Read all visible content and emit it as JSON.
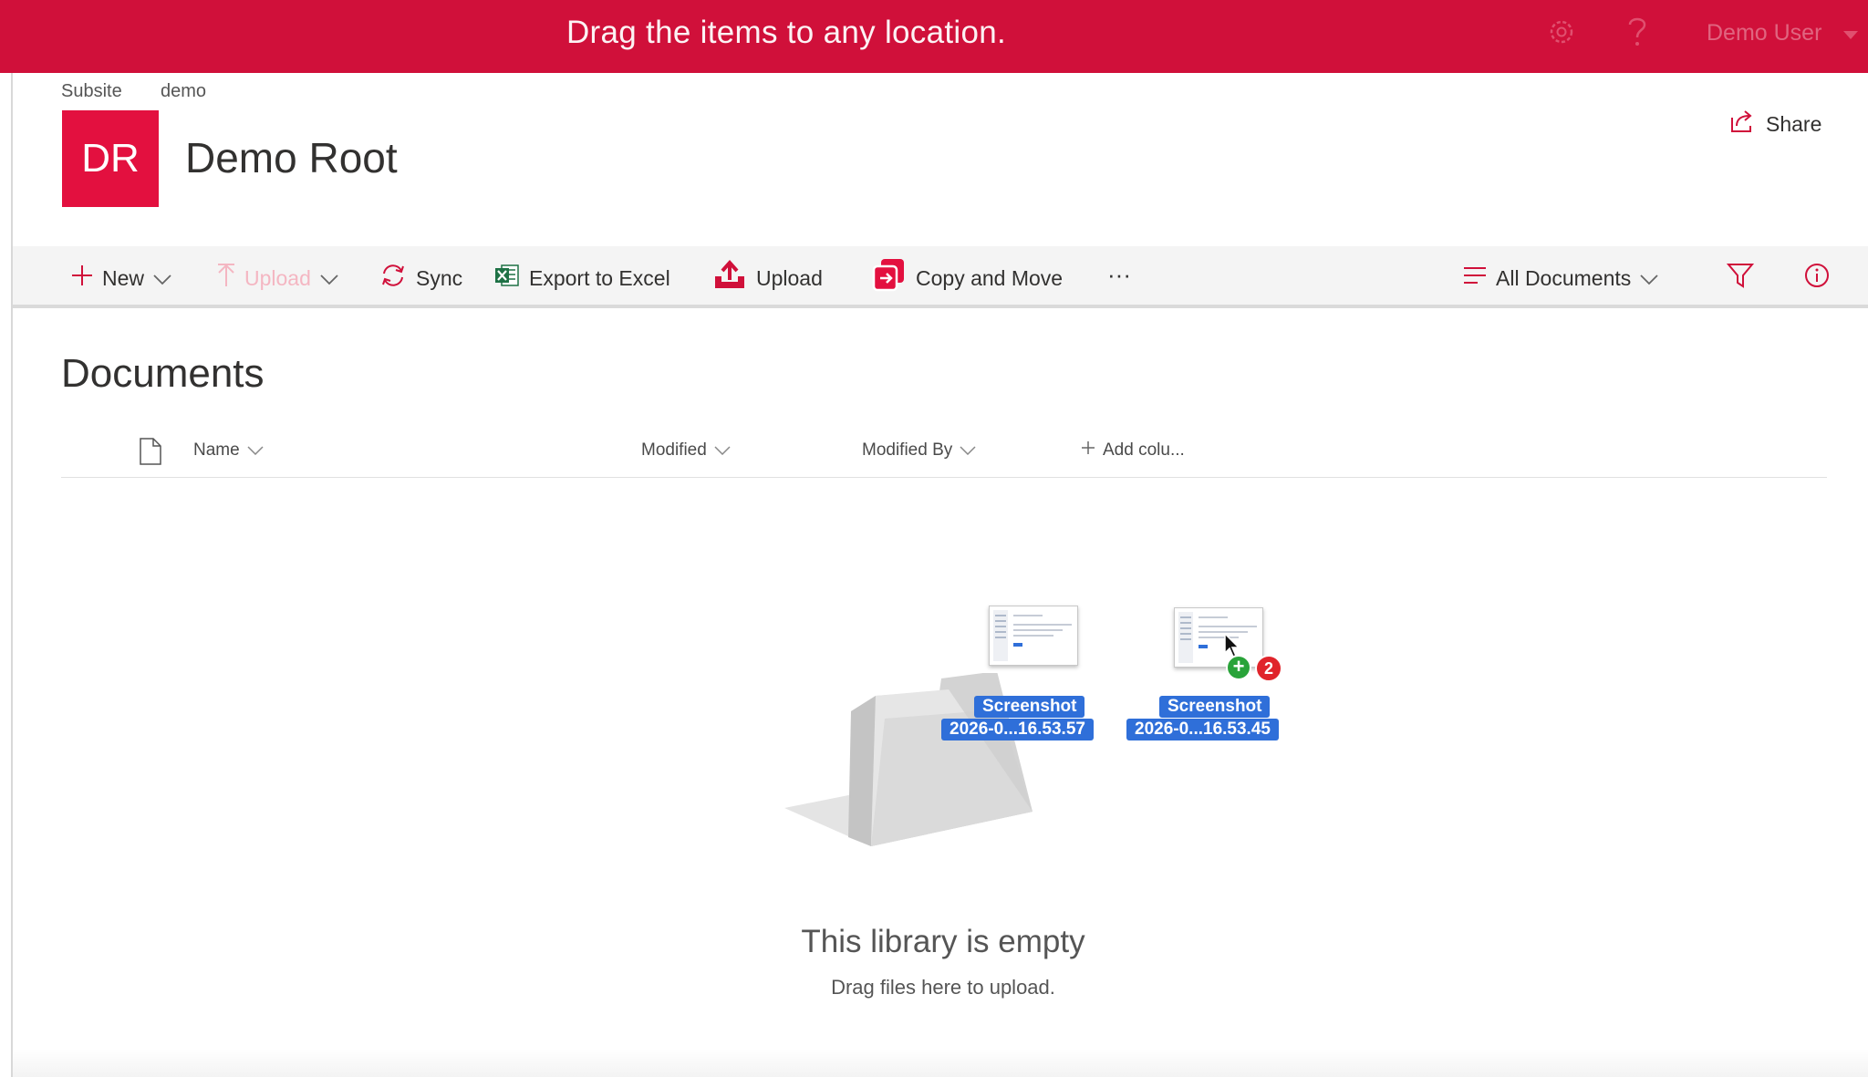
{
  "banner": {
    "message": "Drag the items to any location."
  },
  "top_icons": [
    "gear-icon",
    "help-icon",
    "chevron-down-icon"
  ],
  "user": {
    "name": "Demo User"
  },
  "breadcrumb": [
    {
      "label": "Subsite"
    },
    {
      "label": "demo"
    }
  ],
  "site": {
    "logo_text": "DR",
    "title": "Demo Root",
    "accent_color": "#e3103f"
  },
  "share": {
    "label": "Share"
  },
  "commands": {
    "new": "New",
    "upload_disabled": "Upload",
    "sync": "Sync",
    "export": "Export to Excel",
    "upload": "Upload",
    "copy_move": "Copy and Move",
    "more": "···",
    "view": "All Documents"
  },
  "library": {
    "heading": "Documents",
    "columns": [
      "Name",
      "Modified",
      "Modified By",
      "Add colu..."
    ]
  },
  "empty_state": {
    "title": "This library is empty",
    "subtitle": "Drag files here to upload."
  },
  "drag_items": [
    {
      "line1": "Screenshot",
      "line2": "2026-0...16.53.57"
    },
    {
      "line1": "Screenshot",
      "line2": "2026-0...16.53.45"
    }
  ],
  "drag_badges": {
    "add": "+",
    "count": "2"
  },
  "colors": {
    "topbar": "#d0103a",
    "drag_label": "#2f6fd9",
    "excel_green": "#1e7145"
  }
}
